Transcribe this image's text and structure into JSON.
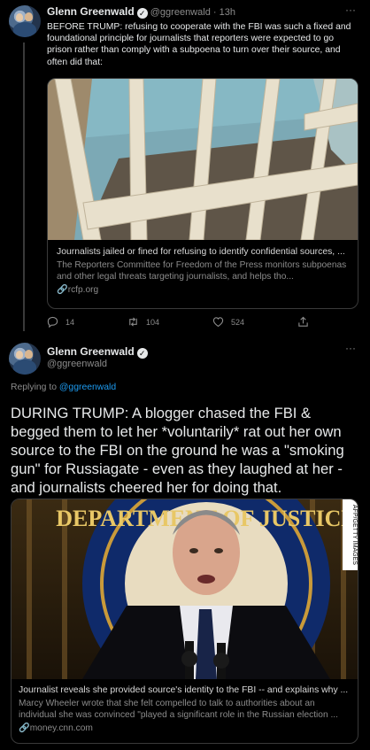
{
  "tweet1": {
    "name": "Glenn Greenwald",
    "handle": "@ggreenwald",
    "time": "13h",
    "more": "···",
    "text": "BEFORE TRUMP: refusing to cooperate with the FBI was such a fixed and foundational principle for journalists that reporters were expected to go prison rather than comply with a subpoena to turn over their source, and often did that:",
    "card": {
      "title": "Journalists jailed or fined for refusing to identify confidential sources, ...",
      "description": "The Reporters Committee for Freedom of the Press monitors subpoenas and other legal threats targeting journalists, and helps tho...",
      "url": "rcfp.org"
    },
    "actions": {
      "replies": "14",
      "retweets": "104",
      "likes": "524"
    }
  },
  "tweet2": {
    "name": "Glenn Greenwald",
    "handle": "@ggreenwald",
    "more": "···",
    "replying_prefix": "Replying to",
    "replying_to": "@ggreenwald",
    "text": "DURING TRUMP: A blogger chased the FBI & begged them to let her *voluntarily* rat out her own source to the FBI on the ground he was a \"smoking gun\" for Russiagate - even as they laughed at her - and journalists cheered her for doing that.",
    "card": {
      "watermark": "AFP/GETTY IMAGES",
      "seal_text": "DEPARTMENT OF JUSTICE",
      "title": "Journalist reveals she provided source's identity to the FBI -- and explains why ...",
      "description": "Marcy Wheeler wrote that she felt compelled to talk to authorities about an individual she was convinced \"played a significant role in the Russian election ...",
      "url": "money.cnn.com"
    }
  }
}
